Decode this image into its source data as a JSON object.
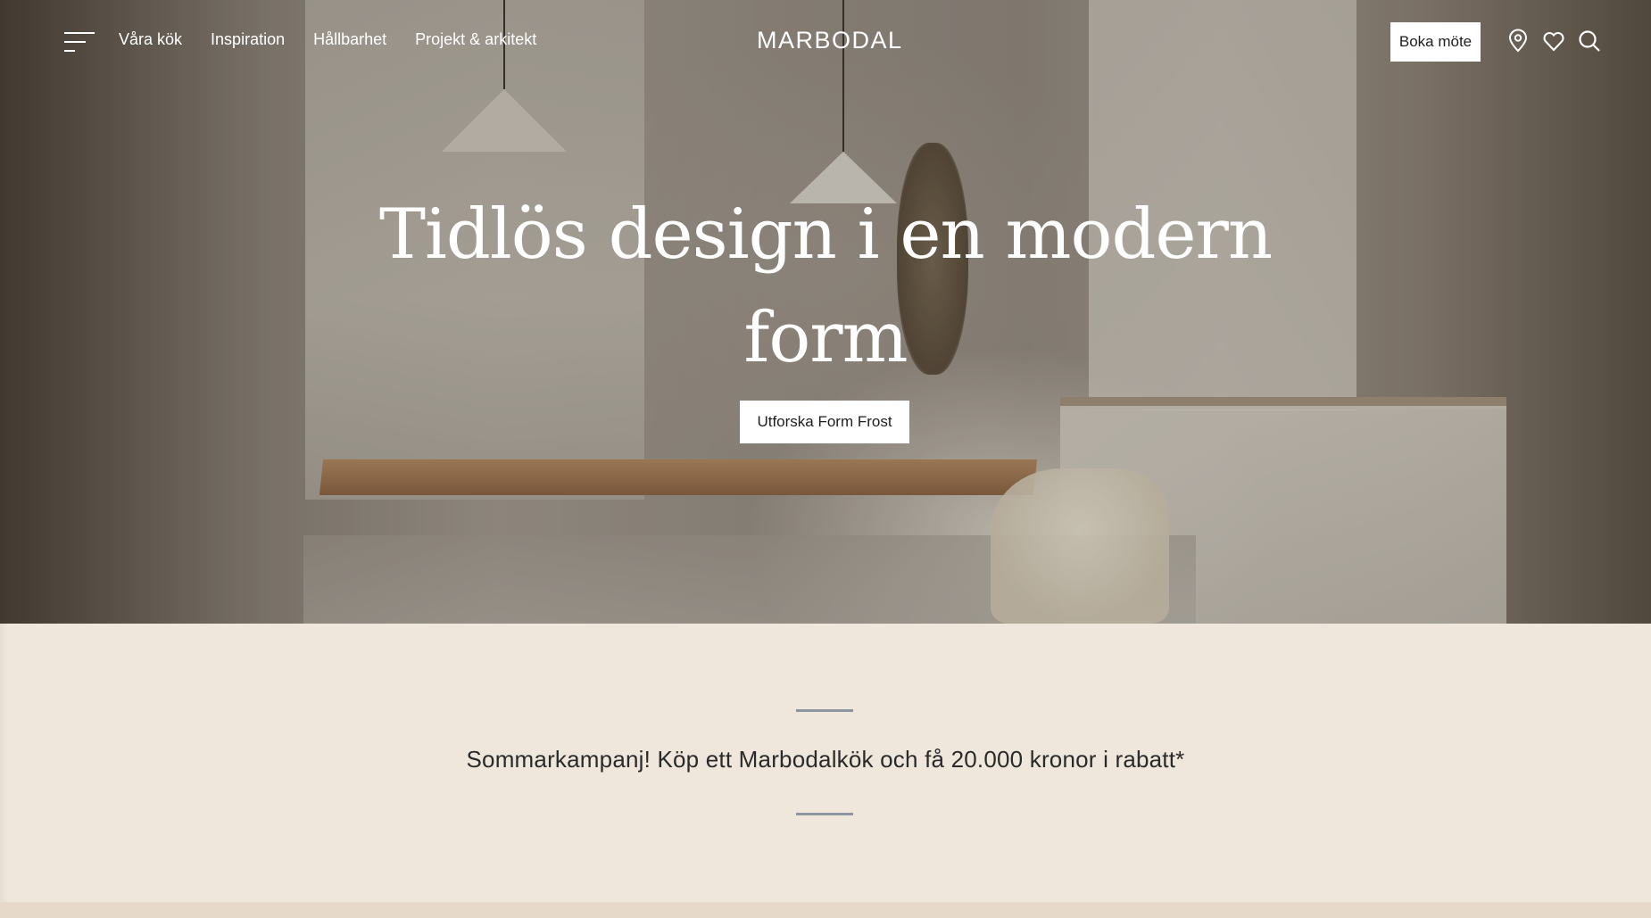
{
  "nav": {
    "links": [
      "Våra kök",
      "Inspiration",
      "Hållbarhet",
      "Projekt & arkitekt"
    ],
    "logo": "MARBODAL",
    "book_label": "Boka möte"
  },
  "icons": {
    "menu": "hamburger-menu-icon",
    "location": "location-pin-icon",
    "favorites": "heart-icon",
    "search": "search-icon"
  },
  "hero": {
    "title_line1": "Tidlös design i en modern",
    "title_line2": "form",
    "cta_label": "Utforska Form Frost"
  },
  "promo": {
    "text": "Sommarkampanj! Köp ett Marbodalkök och få 20.000 kronor i rabatt*"
  },
  "colors": {
    "promo_bg": "#f0e7dc",
    "rule": "#8d96a0",
    "button_bg": "#ffffff"
  }
}
